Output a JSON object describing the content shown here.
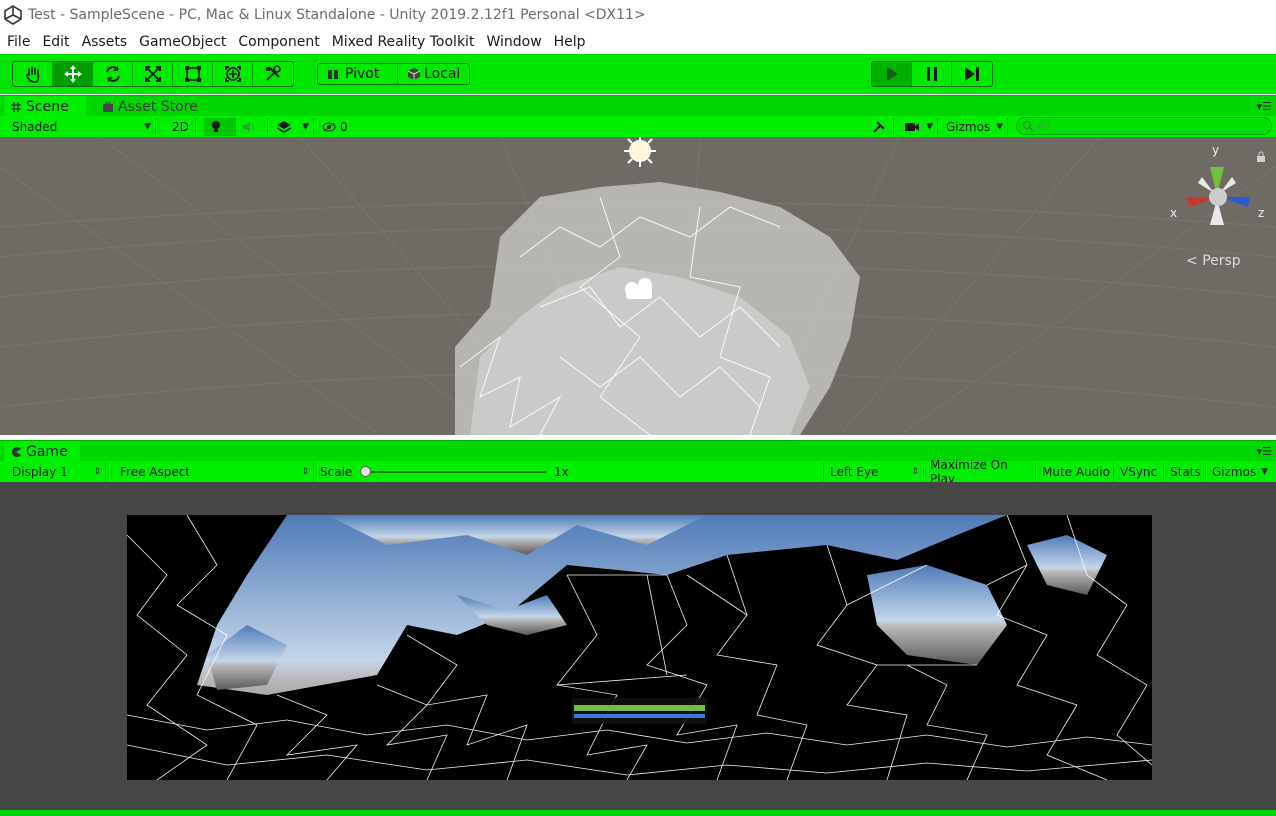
{
  "window": {
    "title": "Test - SampleScene - PC, Mac & Linux Standalone - Unity 2019.2.12f1 Personal <DX11>"
  },
  "menu": [
    "File",
    "Edit",
    "Assets",
    "GameObject",
    "Component",
    "Mixed Reality Toolkit",
    "Window",
    "Help"
  ],
  "toolbar": {
    "tools": [
      "hand-tool",
      "move-tool",
      "rotate-tool",
      "scale-tool",
      "rect-tool",
      "transform-tool",
      "custom-tool"
    ],
    "active_tool": "move-tool",
    "pivot_label": "Pivot",
    "local_label": "Local",
    "play_state": "playing"
  },
  "scene_panel": {
    "tabs": [
      {
        "label": "Scene",
        "active": true
      },
      {
        "label": "Asset Store",
        "active": false
      }
    ],
    "shading_mode": "Shaded",
    "toggle_2d": "2D",
    "hidden_count": "0",
    "gizmos_label": "Gizmos",
    "search_placeholder": "All",
    "axis_labels": {
      "x": "x",
      "y": "y",
      "z": "z"
    },
    "projection": "Persp"
  },
  "game_panel": {
    "tab": "Game",
    "display": "Display 1",
    "aspect": "Free Aspect",
    "scale_label": "Scale",
    "scale_value": "1x",
    "eye": "Left Eye",
    "maximize_on_play": "Maximize On Play",
    "mute_audio": "Mute Audio",
    "vsync": "VSync",
    "stats": "Stats",
    "gizmos": "Gizmos"
  },
  "colors": {
    "accent_green": "#00e600",
    "scene_bg": "#6f6a64",
    "game_bg": "#464646"
  }
}
